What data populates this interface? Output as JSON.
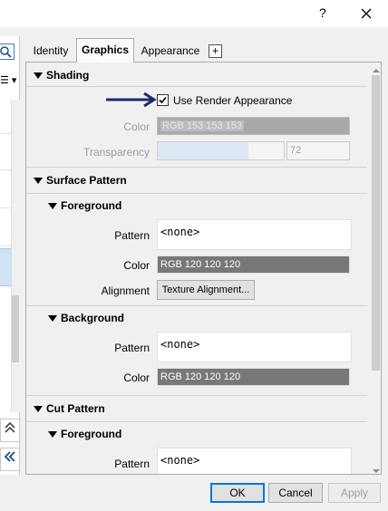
{
  "titlebar": {
    "help_glyph": "?",
    "close_glyph": "✕"
  },
  "left": {
    "menu_glyph": "☰ ▾",
    "collapse_glyph": "⌃",
    "expand_glyph": "«"
  },
  "tabs": [
    {
      "label": "Identity"
    },
    {
      "label": "Graphics",
      "active": true
    },
    {
      "label": "Appearance"
    }
  ],
  "add_tab_glyph": "+",
  "shading": {
    "header": "Shading",
    "use_render_appearance_label": "Use Render Appearance",
    "use_render_appearance_checked": true,
    "color_label": "Color",
    "color_value": "RGB 153 153 153",
    "color_hex": "#999999",
    "transparency_label": "Transparency",
    "transparency_value": "72",
    "transparency_fraction": 0.72
  },
  "surface_pattern": {
    "header": "Surface Pattern",
    "foreground": {
      "header": "Foreground",
      "pattern_label": "Pattern",
      "pattern_value": "<none>",
      "color_label": "Color",
      "color_value": "RGB 120 120 120",
      "color_hex": "#787878",
      "alignment_label": "Alignment",
      "alignment_button": "Texture Alignment..."
    },
    "background": {
      "header": "Background",
      "pattern_label": "Pattern",
      "pattern_value": "<none>",
      "color_label": "Color",
      "color_value": "RGB 120 120 120",
      "color_hex": "#787878"
    }
  },
  "cut_pattern": {
    "header": "Cut Pattern",
    "foreground": {
      "header": "Foreground",
      "pattern_label": "Pattern",
      "pattern_value": "<none>"
    }
  },
  "footer": {
    "ok": "OK",
    "cancel": "Cancel",
    "apply": "Apply"
  },
  "colors": {
    "accent": "#0078d7",
    "arrow": "#1b2a6b"
  }
}
